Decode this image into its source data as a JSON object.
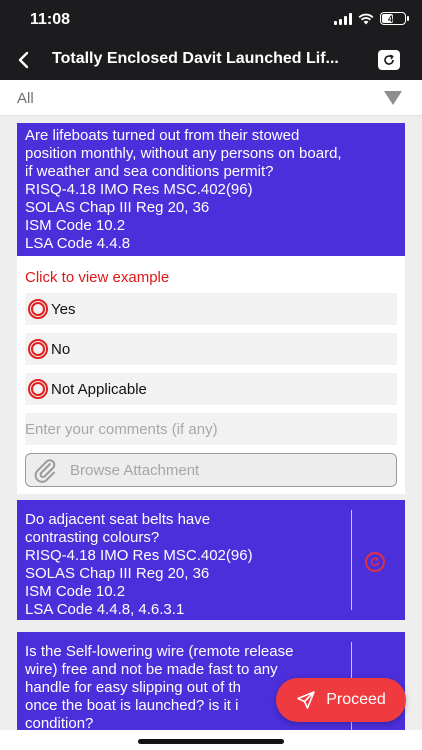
{
  "status_bar": {
    "time": "11:08",
    "battery": "47"
  },
  "header": {
    "title": "Totally Enclosed Davit Launched Lif..."
  },
  "filter": {
    "selected": "All"
  },
  "questions": [
    {
      "lines": [
        "Are lifeboats turned out from their stowed",
        "position monthly, without any persons on board,",
        "if weather and sea conditions permit?",
        "RISQ-4.18  IMO Res MSC.402(96)",
        "SOLAS Chap III Reg 20, 36",
        "ISM Code 10.2",
        "LSA Code  4.4.8"
      ]
    },
    {
      "lines": [
        "Do adjacent seat belts have",
        "contrasting colours?",
        "RISQ-4.18  IMO Res MSC.402(96)",
        "SOLAS Chap III Reg 20, 36",
        "ISM Code 10.2",
        "LSA Code  4.4.8, 4.6.3.1"
      ]
    },
    {
      "lines": [
        "Is the Self-lowering wire (remote release",
        "wire) free and not be made fast to any",
        "handle for easy slipping out of th",
        "once the boat is launched? is it i",
        "condition?"
      ]
    }
  ],
  "answer": {
    "example_link": "Click to view example",
    "options": [
      "Yes",
      "No",
      "Not Applicable"
    ],
    "comments_placeholder": "Enter your comments (if any)",
    "attach_label": "Browse Attachment"
  },
  "fab": {
    "label": "Proceed"
  },
  "colors": {
    "header_bg": "#1c1c1e",
    "question_bg": "#4a2fdb",
    "accent_red": "#ef3a3f",
    "link_red": "#e01818"
  },
  "icons": {
    "back": "chevron-left-icon",
    "refresh": "refresh-icon",
    "dropdown": "caret-down-icon",
    "radio": "radio-icon",
    "attachment": "paperclip-icon",
    "proceed": "send-icon"
  }
}
